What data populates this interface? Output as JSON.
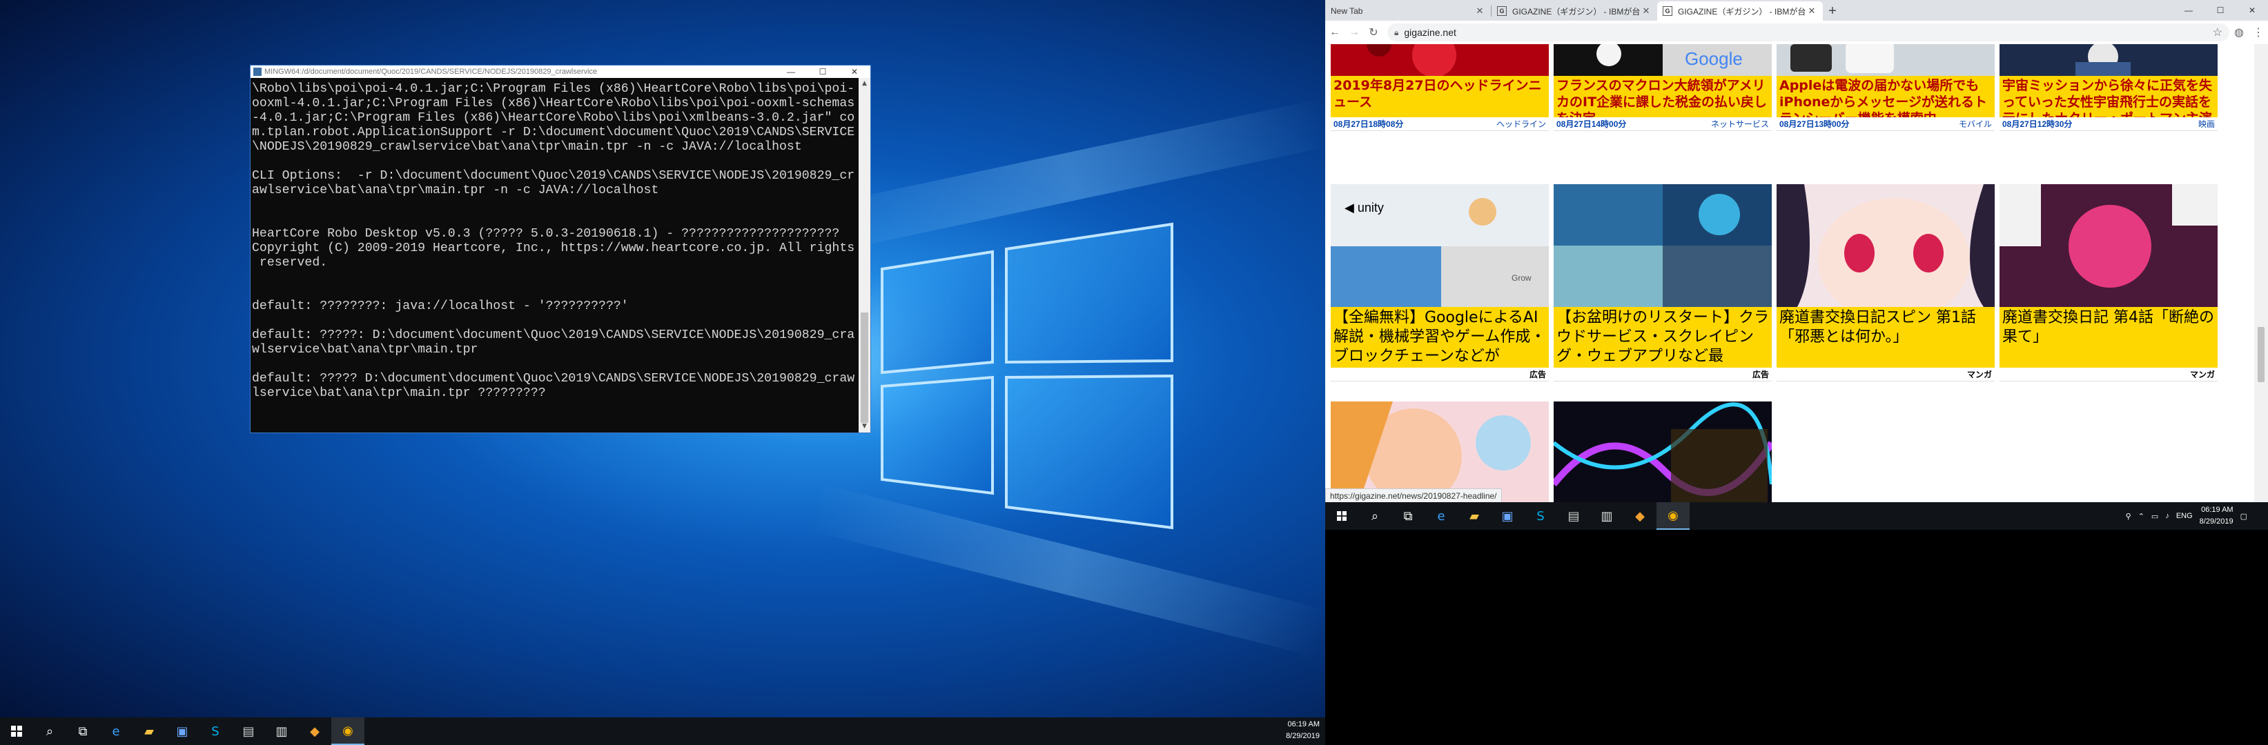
{
  "left": {
    "cmd": {
      "title": "MINGW64:/d/document/document/Quoc/2019/CANDS/SERVICE/NODEJS/20190829_crawlservice",
      "lines": [
        "\\Robo\\libs\\poi\\poi-4.0.1.jar;C:\\Program Files (x86)\\HeartCore\\Robo\\libs\\poi\\poi-",
        "ooxml-4.0.1.jar;C:\\Program Files (x86)\\HeartCore\\Robo\\libs\\poi\\poi-ooxml-schemas",
        "-4.0.1.jar;C:\\Program Files (x86)\\HeartCore\\Robo\\libs\\poi\\xmlbeans-3.0.2.jar\" co",
        "m.tplan.robot.ApplicationSupport -r D:\\document\\document\\Quoc\\2019\\CANDS\\SERVICE",
        "\\NODEJS\\20190829_crawlservice\\bat\\ana\\tpr\\main.tpr -n -c JAVA://localhost",
        "",
        "CLI Options:  -r D:\\document\\document\\Quoc\\2019\\CANDS\\SERVICE\\NODEJS\\20190829_cr",
        "awlservice\\bat\\ana\\tpr\\main.tpr -n -c JAVA://localhost",
        "",
        "",
        "HeartCore Robo Desktop v5.0.3 (????? 5.0.3-20190618.1) - ?????????????????????",
        "Copyright (C) 2009-2019 Heartcore, Inc., https://www.heartcore.co.jp. All rights",
        " reserved.",
        "",
        "",
        "default: ????????: java://localhost - '??????????'",
        "",
        "default: ?????: D:\\document\\document\\Quoc\\2019\\CANDS\\SERVICE\\NODEJS\\20190829_cra",
        "wlservice\\bat\\ana\\tpr\\main.tpr",
        "",
        "default: ????? D:\\document\\document\\Quoc\\2019\\CANDS\\SERVICE\\NODEJS\\20190829_craw",
        "lservice\\bat\\ana\\tpr\\main.tpr ?????????"
      ]
    },
    "taskbar": {
      "time": "06:19 AM",
      "date": "8/29/2019"
    }
  },
  "right": {
    "tabs": [
      {
        "label": "New Tab",
        "favicon": ""
      },
      {
        "label": "GIGAZINE（ギガジン） - IBMが台",
        "favicon": "G"
      },
      {
        "label": "GIGAZINE（ギガジン） - IBMが台",
        "favicon": "G"
      }
    ],
    "url": "gigazine.net",
    "status_url": "https://gigazine.net/news/20190827-headline/",
    "taskbar": {
      "lang": "ENG",
      "time": "06:19 AM",
      "date": "8/29/2019"
    },
    "cards": [
      {
        "title": "2019年8月27日のヘッドラインニュース",
        "date": "08月27日18時08分",
        "category": "ヘッドライン",
        "thumb": "thumb-red"
      },
      {
        "title": "フランスのマクロン大統領がアメリカのIT企業に課した税金の払い戻しを決定",
        "date": "08月27日14時00分",
        "category": "ネットサービス",
        "thumb": "thumb-tech"
      },
      {
        "title": "Appleは電波の届かない場所でもiPhoneからメッセージが送れるトランシーバー機能を模索中",
        "date": "08月27日13時00分",
        "category": "モバイル",
        "thumb": "thumb-phone"
      },
      {
        "title": "宇宙ミッションから徐々に正気を失っていった女性宇宙飛行士の実話を元にしたナタリー・ポートマン主演",
        "date": "08月27日12時30分",
        "category": "映画",
        "thumb": "thumb-space"
      },
      {
        "title": "【全編無料】GoogleによるAI解説・機械学習やゲーム作成・ブロックチェーンなどが",
        "category": "広告",
        "thumb": "thumb-unity"
      },
      {
        "title": "【お盆明けのリスタート】クラウドサービス・スクレイピング・ウェブアプリなど最",
        "category": "広告",
        "thumb": "thumb-cloud"
      },
      {
        "title": "廃道書交換日記スピン 第1話「邪悪とは何か。」",
        "category": "マンガ",
        "thumb": "thumb-manga1"
      },
      {
        "title": "廃道書交換日記 第4話「断絶の果て」",
        "category": "マンガ",
        "thumb": "thumb-manga2"
      }
    ]
  }
}
